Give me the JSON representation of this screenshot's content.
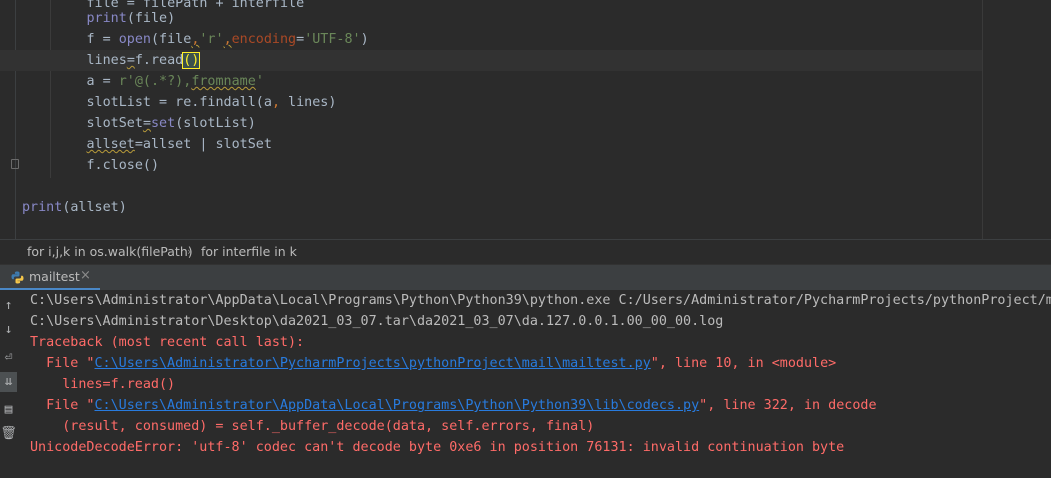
{
  "editor": {
    "lines": [
      {
        "indent": "        ",
        "parts": [
          [
            "plain",
            "file = filePath + interfile"
          ]
        ],
        "partial": true
      },
      {
        "indent": "        ",
        "parts": [
          [
            "bi",
            "print"
          ],
          [
            "plain",
            "(file)"
          ]
        ]
      },
      {
        "indent": "        ",
        "parts": [
          [
            "plain",
            "f = "
          ],
          [
            "bi",
            "open"
          ],
          [
            "plain",
            "(file"
          ],
          [
            "kwwarn",
            ","
          ],
          [
            "str",
            "'r'"
          ],
          [
            "kwwarn",
            ","
          ],
          [
            "kwarg",
            "encoding"
          ],
          [
            "plain",
            "="
          ],
          [
            "str",
            "'UTF-8'"
          ],
          [
            "plain",
            ")"
          ]
        ]
      },
      {
        "indent": "        ",
        "parts": [
          [
            "plain",
            "lines"
          ],
          [
            "warnplain",
            "="
          ],
          [
            "plain",
            "f.read"
          ],
          [
            "brace",
            "()"
          ]
        ],
        "current": true
      },
      {
        "indent": "        ",
        "parts": [
          [
            "plain",
            "a = "
          ],
          [
            "str",
            "r'@(.*?),"
          ],
          [
            "strwarn",
            "fromname"
          ],
          [
            "str",
            "'"
          ]
        ]
      },
      {
        "indent": "        ",
        "parts": [
          [
            "plain",
            "slotList = re.findall(a"
          ],
          [
            "kw",
            ","
          ],
          [
            "plain",
            " lines)"
          ]
        ]
      },
      {
        "indent": "        ",
        "parts": [
          [
            "plain",
            "slotSet"
          ],
          [
            "warnplain",
            "="
          ],
          [
            "bi",
            "set"
          ],
          [
            "plain",
            "(slotList)"
          ]
        ]
      },
      {
        "indent": "        ",
        "parts": [
          [
            "warnplain",
            "allset"
          ],
          [
            "plain",
            "=allset | slotSet"
          ]
        ]
      },
      {
        "indent": "        ",
        "parts": [
          [
            "plain",
            "f.close()"
          ]
        ]
      },
      {
        "indent": "",
        "parts": []
      },
      {
        "indent": "",
        "parts": [
          [
            "bi",
            "print"
          ],
          [
            "plain",
            "(allset)"
          ]
        ]
      }
    ]
  },
  "breadcrumb": {
    "items": [
      "for i,j,k in os.walk(filePath)",
      "for interfile in k"
    ],
    "separator": "›"
  },
  "run_panel": {
    "tab_label": "mailtest",
    "close_glyph": "×",
    "icon": "python-icon"
  },
  "console": {
    "cmd_line": "C:\\Users\\Administrator\\AppData\\Local\\Programs\\Python\\Python39\\python.exe C:/Users/Administrator/PycharmProjects/pythonProject/ma",
    "output_line": "C:\\Users\\Administrator\\Desktop\\da2021_03_07.tar\\da2021_03_07\\da.127.0.0.1.00_00_00.log",
    "traceback_header": "Traceback (most recent call last):",
    "frame1_prefix": "  File \"",
    "frame1_path": "C:\\Users\\Administrator\\PycharmProjects\\pythonProject\\mail\\mailtest.py",
    "frame1_suffix": "\", line 10, in <module>",
    "frame1_code": "    lines=f.read()",
    "frame2_prefix": "  File \"",
    "frame2_path": "C:\\Users\\Administrator\\AppData\\Local\\Programs\\Python\\Python39\\lib\\codecs.py",
    "frame2_suffix": "\", line 322, in decode",
    "frame2_code": "    (result, consumed) = self._buffer_decode(data, self.errors, final)",
    "error_line": "UnicodeDecodeError: 'utf-8' codec can't decode byte 0xe6 in position 76131: invalid continuation byte"
  },
  "toolbar_icons": [
    "arrow-up-icon",
    "arrow-down-icon",
    "soft-wrap-icon",
    "scroll-to-end-icon",
    "print-icon",
    "trash-icon"
  ],
  "colors": {
    "editor_bg": "#2b2b2b",
    "keyword": "#cc7832",
    "string": "#6a8759",
    "builtin": "#8888c6",
    "error": "#ff6b68",
    "link": "#287bde"
  }
}
